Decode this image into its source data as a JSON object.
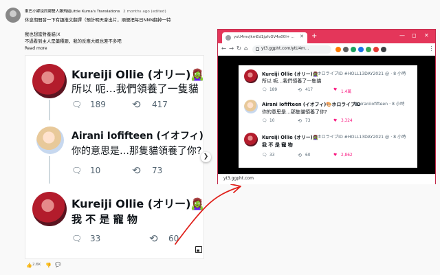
{
  "post": {
    "author": "東巴小鄉說同鄉雙人雕飛組Little Kuma's Translations",
    "time": "2 months ago (edited)",
    "lines": [
      "休息期間發一下有趣推文翻譯（預計明天會出片，順便把每日NNN翻掉一特",
      "",
      "我也想當對養貓(X",
      "不過看到主人是藥種跟，我的反應大概也差不多吧"
    ],
    "read_more": "Read more",
    "like_count": "2.6K"
  },
  "tweets": [
    {
      "name": "Kureiji Ollie (オリー)🧟‍♀️ @ホロラ",
      "text": "所以 呃…我們領養了一隻貓",
      "replies": "189",
      "retweets": "417"
    },
    {
      "name": "Airani Iofifteen (イオフィ)🎨ホロ",
      "text": "你的意思是…那隻貓領養了你?",
      "replies": "10",
      "retweets": "73"
    },
    {
      "name": "Kureiji Ollie (オリー)🧟‍♀️ @ホロラ",
      "text": "我 不 是 寵 物",
      "replies": "33",
      "retweets": "60"
    }
  ],
  "browser": {
    "tab_title": "yoU4mvJkmEd1jpfcGV4a00l+ ...",
    "url": "yt3.ggpht.com/ytU4m...",
    "status_url": "yt3.ggpht.com",
    "new_tab": "+",
    "minimize": "—",
    "maximize": "◻",
    "close": "✕",
    "back": "←",
    "forward": "→",
    "reload": "↻",
    "home": "⌂",
    "menu": "⋮",
    "ext_colors": [
      "#ff7a00",
      "#5e5e5e",
      "#1aa260",
      "#1a73e8",
      "#34a853",
      "#e53935",
      "#3c4043"
    ]
  },
  "card_tweets": [
    {
      "name": "Kureiji Ollie (オリー)🧟‍♀️",
      "handle": "@ホロライブID #HOLL13DAY2021 @ · 8 小時",
      "text": "所以 呃…我們領養了一隻貓",
      "replies": "189",
      "retweets": "417",
      "likes": "1.4萬"
    },
    {
      "name": "Airani Iofifteen (イオフィ)🎨ホロライブID",
      "handle": "@airaniiofifteen · 8 小時",
      "text": "你的意思是…那隻貓領養了你?",
      "replies": "10",
      "retweets": "73",
      "likes": "3,324"
    },
    {
      "name": "Kureiji Ollie (オリー)🧟‍♀️",
      "handle": "@ホロライブID #HOLL13DAY2021 @ · 8 小時",
      "text": "我 不 是 寵 物",
      "replies": "33",
      "retweets": "60",
      "likes": "2,862"
    }
  ],
  "icons": {
    "reply": "🗨",
    "retweet": "⟲",
    "like": "♥",
    "next": "❯",
    "thumb_up": "👍",
    "thumb_down": "👎",
    "comment": "💬"
  }
}
